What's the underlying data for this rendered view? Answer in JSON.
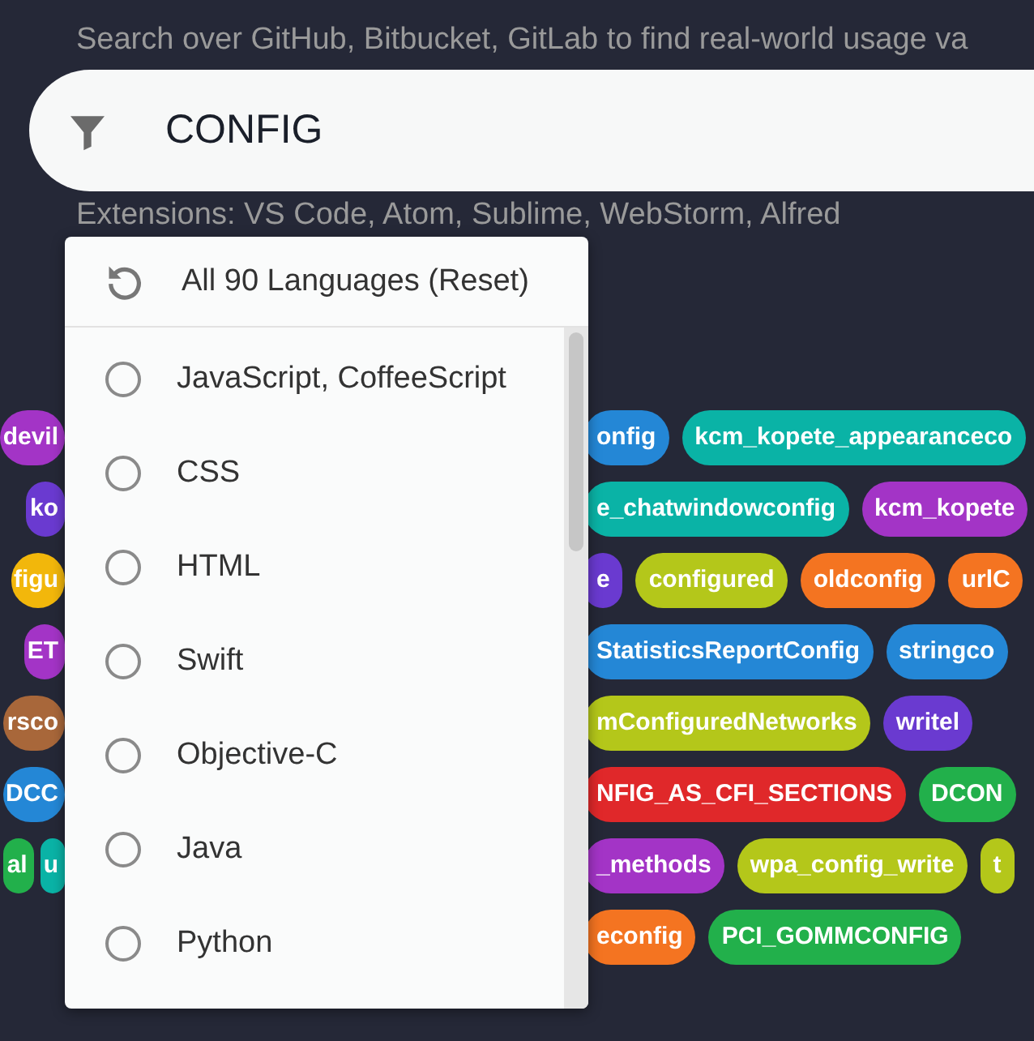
{
  "subtitle": "Search over GitHub, Bitbucket, GitLab to find real-world usage va",
  "search": {
    "value": "CONFIG"
  },
  "extensions": "Extensions: VS Code, Atom, Sublime, WebStorm, Alfred",
  "tag_rows": [
    {
      "left": [
        {
          "text": "devil",
          "color": "#a334c6"
        }
      ],
      "right": [
        {
          "text": "onfig",
          "color": "#2487d6"
        },
        {
          "text": "kcm_kopete_appearanceco",
          "color": "#0ab3a6"
        }
      ]
    },
    {
      "left": [
        {
          "text": "ko",
          "color": "#6a3ad0"
        }
      ],
      "right": [
        {
          "text": "e_chatwindowconfig",
          "color": "#0ab3a6"
        },
        {
          "text": "kcm_kopete",
          "color": "#a334c6"
        }
      ]
    },
    {
      "left": [
        {
          "text": "figu",
          "color": "#f2b70b"
        }
      ],
      "right": [
        {
          "text": "e",
          "color": "#6a3ad0"
        },
        {
          "text": "configured",
          "color": "#b4c71a"
        },
        {
          "text": "oldconfig",
          "color": "#f47421"
        },
        {
          "text": "urlC",
          "color": "#f47421"
        }
      ]
    },
    {
      "left": [
        {
          "text": "ET",
          "color": "#a334c6"
        }
      ],
      "right": [
        {
          "text": "StatisticsReportConfig",
          "color": "#2487d6"
        },
        {
          "text": "stringco",
          "color": "#2487d6"
        }
      ]
    },
    {
      "left": [
        {
          "text": "rsco",
          "color": "#a8673a"
        }
      ],
      "right": [
        {
          "text": "mConfiguredNetworks",
          "color": "#b4c71a"
        },
        {
          "text": "writel",
          "color": "#6a3ad0"
        }
      ]
    },
    {
      "left": [
        {
          "text": "DCC",
          "color": "#2487d6"
        }
      ],
      "right": [
        {
          "text": "NFIG_AS_CFI_SECTIONS",
          "color": "#e0282a"
        },
        {
          "text": "DCON",
          "color": "#22b04b"
        }
      ]
    },
    {
      "left": [
        {
          "text": "al",
          "color": "#22b04b"
        },
        {
          "text": "u",
          "color": "#0ab3a6"
        }
      ],
      "right": [
        {
          "text": "_methods",
          "color": "#a334c6"
        },
        {
          "text": "wpa_config_write",
          "color": "#b4c71a"
        },
        {
          "text": "t",
          "color": "#b4c71a"
        }
      ]
    },
    {
      "left": [],
      "right": [
        {
          "text": "econfig",
          "color": "#f47421"
        },
        {
          "text": "PCI_GOMMCONFIG",
          "color": "#22b04b"
        }
      ]
    }
  ],
  "language_menu": {
    "reset": "All 90 Languages (Reset)",
    "languages": [
      {
        "label": "JavaScript, CoffeeScript",
        "selected": false
      },
      {
        "label": "CSS",
        "selected": false
      },
      {
        "label": "HTML",
        "selected": false
      },
      {
        "label": "Swift",
        "selected": false
      },
      {
        "label": "Objective-C",
        "selected": false
      },
      {
        "label": "Java",
        "selected": false
      },
      {
        "label": "Python",
        "selected": false
      }
    ]
  }
}
